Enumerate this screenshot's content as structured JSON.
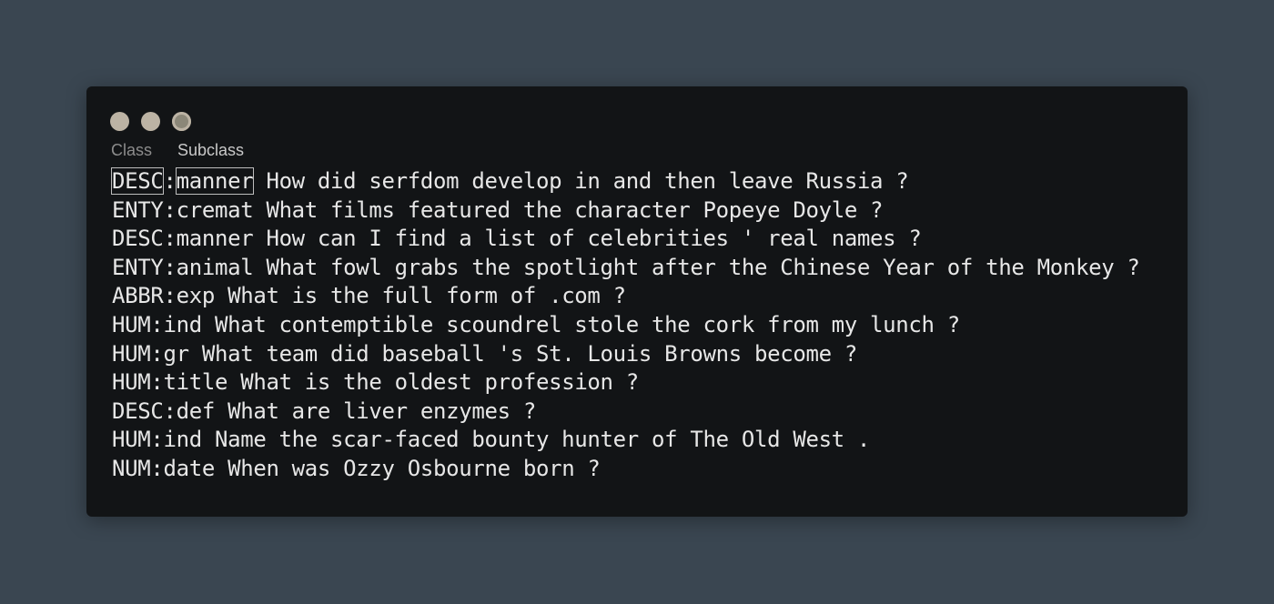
{
  "header": {
    "class_label": "Class",
    "subclass_label": "Subclass"
  },
  "lines": [
    {
      "cls": "DESC",
      "sub": "manner",
      "text": " How did serfdom develop in and then leave Russia ?"
    },
    {
      "cls": "ENTY",
      "sub": "cremat",
      "text": " What films featured the character Popeye Doyle ?"
    },
    {
      "cls": "DESC",
      "sub": "manner",
      "text": " How can I find a list of celebrities ' real names ?"
    },
    {
      "cls": "ENTY",
      "sub": "animal",
      "text": " What fowl grabs the spotlight after the Chinese Year of the Monkey ?"
    },
    {
      "cls": "ABBR",
      "sub": "exp",
      "text": " What is the full form of .com ?"
    },
    {
      "cls": "HUM",
      "sub": "ind",
      "text": " What contemptible scoundrel stole the cork from my lunch ?"
    },
    {
      "cls": "HUM",
      "sub": "gr",
      "text": " What team did baseball 's St. Louis Browns become ?"
    },
    {
      "cls": "HUM",
      "sub": "title",
      "text": " What is the oldest profession ?"
    },
    {
      "cls": "DESC",
      "sub": "def",
      "text": " What are liver enzymes ?"
    },
    {
      "cls": "HUM",
      "sub": "ind",
      "text": " Name the scar-faced bounty hunter of The Old West ."
    },
    {
      "cls": "NUM",
      "sub": "date",
      "text": " When was Ozzy Osbourne born ?"
    }
  ]
}
